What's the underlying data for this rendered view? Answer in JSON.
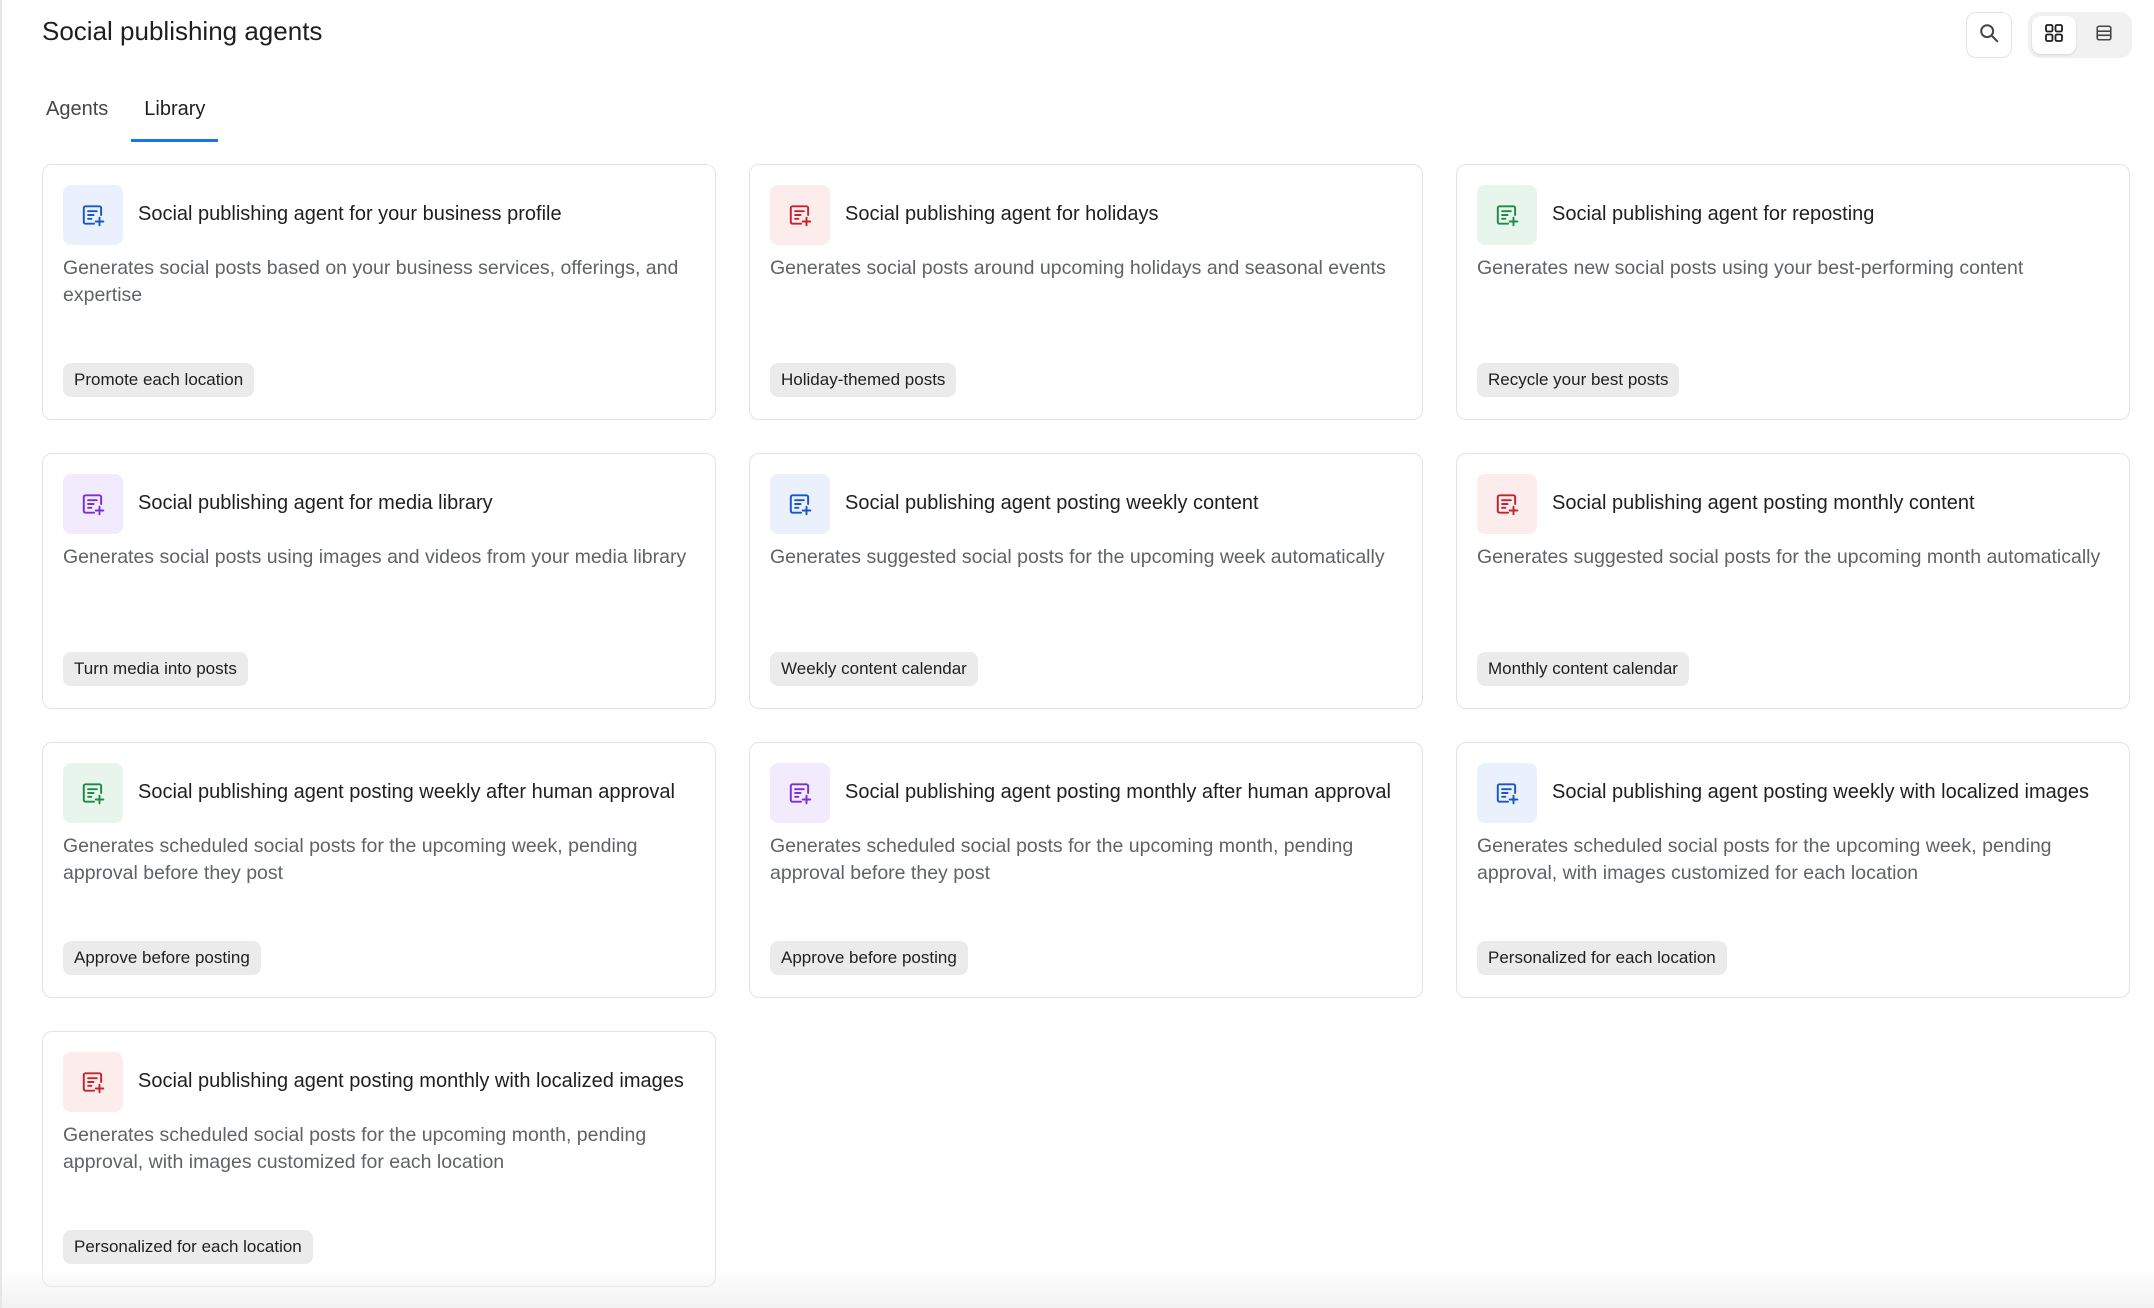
{
  "header": {
    "title": "Social publishing agents"
  },
  "tabs": [
    {
      "label": "Agents",
      "active": false
    },
    {
      "label": "Library",
      "active": true
    }
  ],
  "toolbar": {
    "search_icon": "search-icon",
    "view_modes": [
      {
        "icon": "grid-view-icon",
        "active": true
      },
      {
        "icon": "list-view-icon",
        "active": false
      }
    ]
  },
  "colors": {
    "blue": {
      "bg": "#eaf1fd",
      "fg": "#1a56c4"
    },
    "red": {
      "bg": "#fdecec",
      "fg": "#c5222f"
    },
    "green": {
      "bg": "#e7f5ec",
      "fg": "#1e8a4a"
    },
    "purple": {
      "bg": "#f1ebfd",
      "fg": "#7b2fd4"
    },
    "tab_underline": "#1a73e8"
  },
  "cards": [
    {
      "title": "Social publishing agent for your business profile",
      "description": "Generates social posts based on your business services, offerings, and expertise",
      "tag": "Promote each location",
      "icon": "post-sparkle-icon",
      "color": "blue"
    },
    {
      "title": "Social publishing agent for holidays",
      "description": "Generates social posts around upcoming holidays and seasonal events",
      "tag": "Holiday-themed posts",
      "icon": "post-sparkle-icon",
      "color": "red"
    },
    {
      "title": "Social publishing agent for reposting",
      "description": "Generates new social posts using your best-performing content",
      "tag": "Recycle your best posts",
      "icon": "post-sparkle-icon",
      "color": "green"
    },
    {
      "title": "Social publishing agent for media library",
      "description": "Generates social posts using images and videos from your media library",
      "tag": "Turn media into posts",
      "icon": "post-sparkle-icon",
      "color": "purple"
    },
    {
      "title": "Social publishing agent posting weekly content",
      "description": "Generates suggested social posts for the upcoming week automatically",
      "tag": "Weekly content calendar",
      "icon": "post-sparkle-icon",
      "color": "blue"
    },
    {
      "title": "Social publishing agent posting monthly content",
      "description": "Generates suggested social posts for the upcoming month automatically",
      "tag": "Monthly content calendar",
      "icon": "post-sparkle-icon",
      "color": "red"
    },
    {
      "title": "Social publishing agent posting weekly after human approval",
      "description": "Generates scheduled social posts for the upcoming week, pending approval before they post",
      "tag": "Approve before posting",
      "icon": "post-sparkle-icon",
      "color": "green"
    },
    {
      "title": "Social publishing agent posting monthly after human approval",
      "description": "Generates scheduled social posts for the upcoming month, pending approval before they post",
      "tag": "Approve before posting",
      "icon": "post-sparkle-icon",
      "color": "purple"
    },
    {
      "title": "Social publishing agent posting weekly with localized images",
      "description": "Generates scheduled social posts for the upcoming week, pending approval, with images customized for each location",
      "tag": "Personalized for each location",
      "icon": "post-sparkle-icon",
      "color": "blue"
    },
    {
      "title": "Social publishing agent posting monthly with localized images",
      "description": "Generates scheduled social posts for the upcoming month, pending approval, with images customized for each location",
      "tag": "Personalized for each location",
      "icon": "post-sparkle-icon",
      "color": "red"
    }
  ]
}
